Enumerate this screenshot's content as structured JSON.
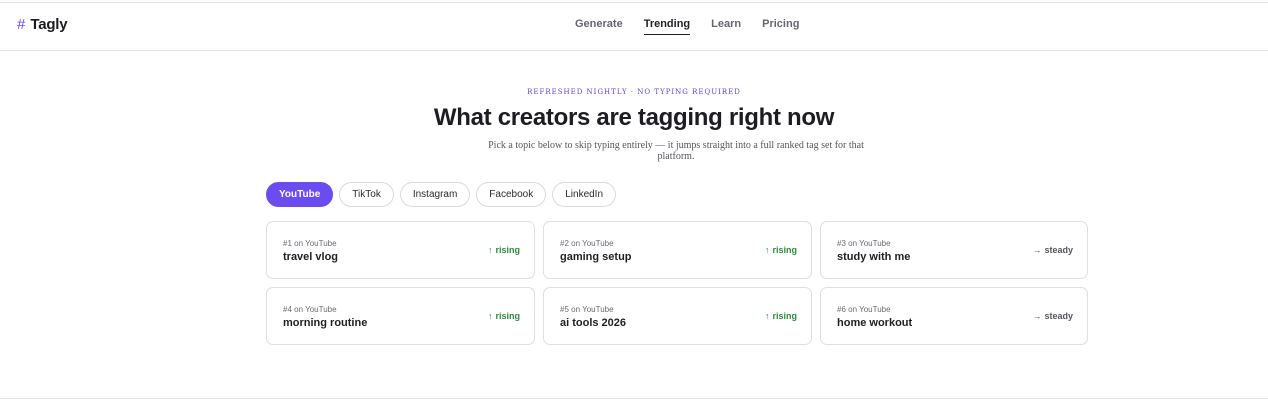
{
  "brand": {
    "icon": "hash-icon",
    "symbol": "#",
    "name": "Tagly",
    "accent": "#6a4cf0"
  },
  "nav": {
    "items": [
      {
        "label": "Generate",
        "active": false
      },
      {
        "label": "Trending",
        "active": true
      },
      {
        "label": "Learn",
        "active": false
      },
      {
        "label": "Pricing",
        "active": false
      }
    ]
  },
  "hero": {
    "eyebrow": "Refreshed nightly · No typing required",
    "title": "What creators are tagging right now",
    "subtitle": "Pick a topic below to skip typing entirely — it jumps straight into a full ranked tag set for that platform."
  },
  "platforms": {
    "items": [
      {
        "label": "YouTube",
        "active": true
      },
      {
        "label": "TikTok",
        "active": false
      },
      {
        "label": "Instagram",
        "active": false
      },
      {
        "label": "Facebook",
        "active": false
      },
      {
        "label": "LinkedIn",
        "active": false
      }
    ]
  },
  "cards": [
    {
      "rank": "#1 on YouTube",
      "tag": "travel vlog",
      "trend_icon": "↑",
      "trend": "rising",
      "status": "rising"
    },
    {
      "rank": "#2 on YouTube",
      "tag": "gaming setup",
      "trend_icon": "↑",
      "trend": "rising",
      "status": "rising"
    },
    {
      "rank": "#3 on YouTube",
      "tag": "study with me",
      "trend_icon": "→",
      "trend": "steady",
      "status": "steady"
    },
    {
      "rank": "#4 on YouTube",
      "tag": "morning routine",
      "trend_icon": "↑",
      "trend": "rising",
      "status": "rising"
    },
    {
      "rank": "#5 on YouTube",
      "tag": "ai tools 2026",
      "trend_icon": "↑",
      "trend": "rising",
      "status": "rising"
    },
    {
      "rank": "#6 on YouTube",
      "tag": "home workout",
      "trend_icon": "→",
      "trend": "steady",
      "status": "steady"
    }
  ],
  "colors": {
    "rising": "#2f8a3e",
    "steady": "#55555c",
    "active_tab": "#6a4cf0"
  }
}
